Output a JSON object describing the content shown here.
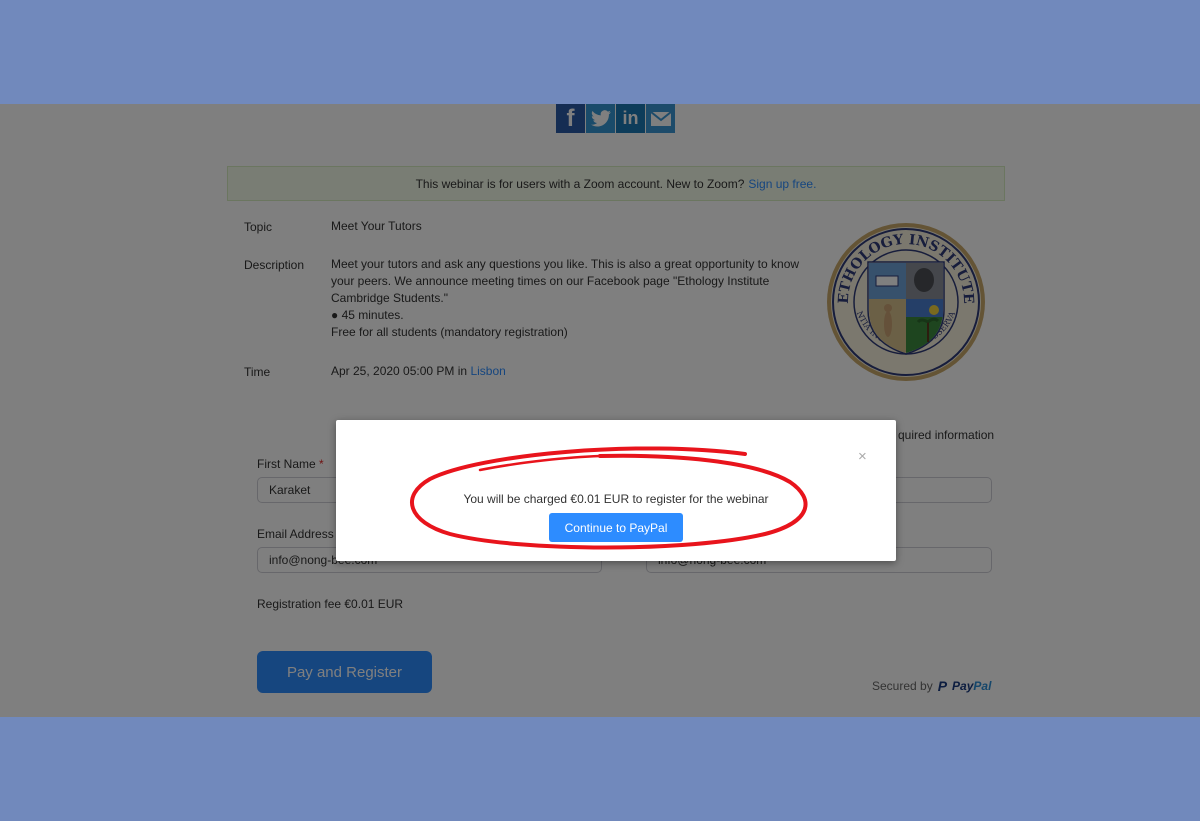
{
  "share": {
    "facebook_glyph": "f",
    "linkedin_glyph": "in",
    "icons": [
      "facebook-icon",
      "twitter-icon",
      "linkedin-icon",
      "email-icon"
    ]
  },
  "notice": {
    "text": "This webinar is for users with a Zoom account. New to Zoom?",
    "link": "Sign up free."
  },
  "details": {
    "topic_label": "Topic",
    "topic_value": "Meet Your Tutors",
    "description_label": "Description",
    "description_lines": [
      "Meet your tutors and ask any questions you like. This is also a great opportunity to know",
      "your peers. We announce meeting times on our Facebook page \"Ethology Institute",
      "Cambridge Students.\"",
      "● 45 minutes.",
      "Free for all students (mandatory registration)"
    ],
    "time_label": "Time",
    "time_value": "Apr 25, 2020 05:00 PM in",
    "time_zone_link": "Lisbon"
  },
  "seal": {
    "top_text": "ETHOLOGY INSTITUTE",
    "bottom_text": "SCIENTIA INTELLECTUS OBSERVANTIA"
  },
  "form": {
    "required_info": "quired information",
    "first_name_label": "First Name",
    "required_star": "*",
    "first_name_value": "Karaket",
    "email_label": "Email Address",
    "email_value": "info@nong-bee.com",
    "email_confirm_value": "info@nong-bee.com",
    "fee_text": "Registration fee €0.01 EUR",
    "pay_button": "Pay and Register",
    "secured_by": "Secured by",
    "paypal_pay": "Pay",
    "paypal_pal": "Pal",
    "paypal_mark": "P"
  },
  "modal": {
    "close": "×",
    "message": "You will be charged €0.01 EUR to register for the webinar",
    "continue_button": "Continue to PayPal"
  },
  "colors": {
    "band": "#7189bc",
    "zoom_blue": "#2d8cff",
    "annotation_red": "#e8141c"
  }
}
